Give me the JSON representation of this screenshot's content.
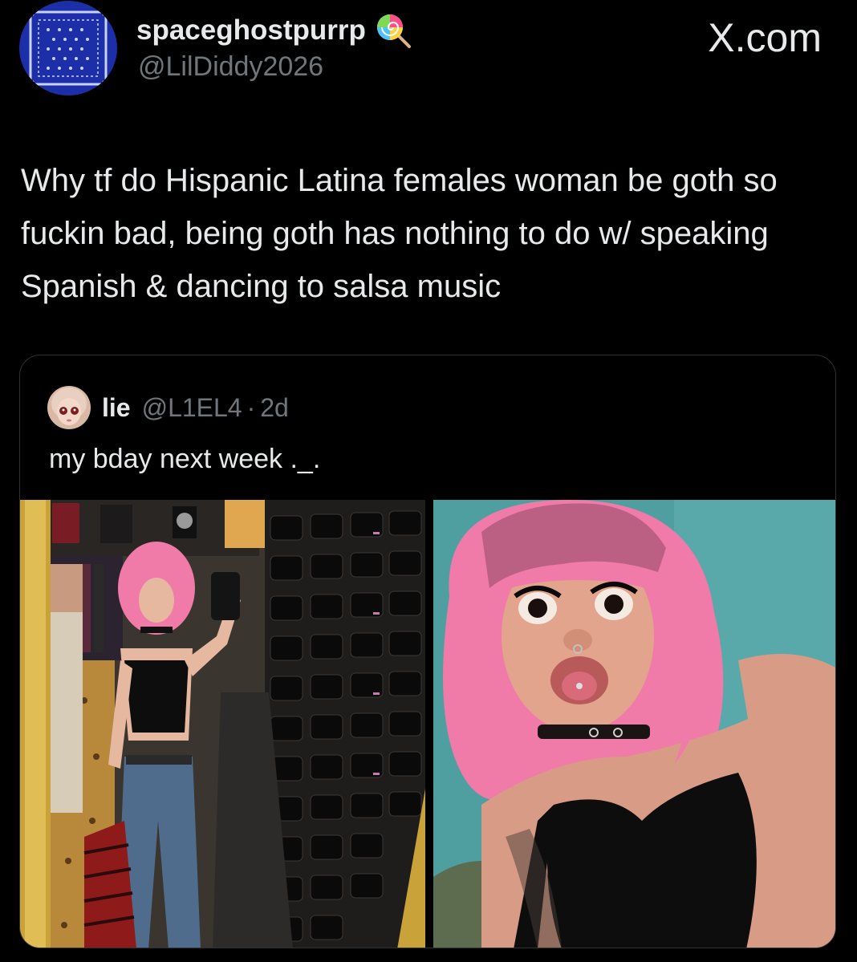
{
  "tweet": {
    "display_name": "spaceghostpurrp",
    "badge_icon": "lollipop-icon",
    "handle": "@LilDiddy2026",
    "site": "X.com",
    "text": "Why tf do Hispanic Latina females woman be goth so fuckin bad, being goth has nothing to do w/ speaking Spanish & dancing to salsa music"
  },
  "quoted_tweet": {
    "display_name": "lie",
    "handle": "@L1EL4",
    "separator": "·",
    "time": "2d",
    "text": "my bday next week ._.",
    "photos": [
      {
        "name": "mirror-selfie-photo"
      },
      {
        "name": "closeup-selfie-photo"
      }
    ]
  },
  "colors": {
    "background": "#000000",
    "text_primary": "#e7e9ea",
    "text_secondary": "#71767b",
    "border": "#2f3336",
    "hair_pink": "#f07aa8"
  }
}
